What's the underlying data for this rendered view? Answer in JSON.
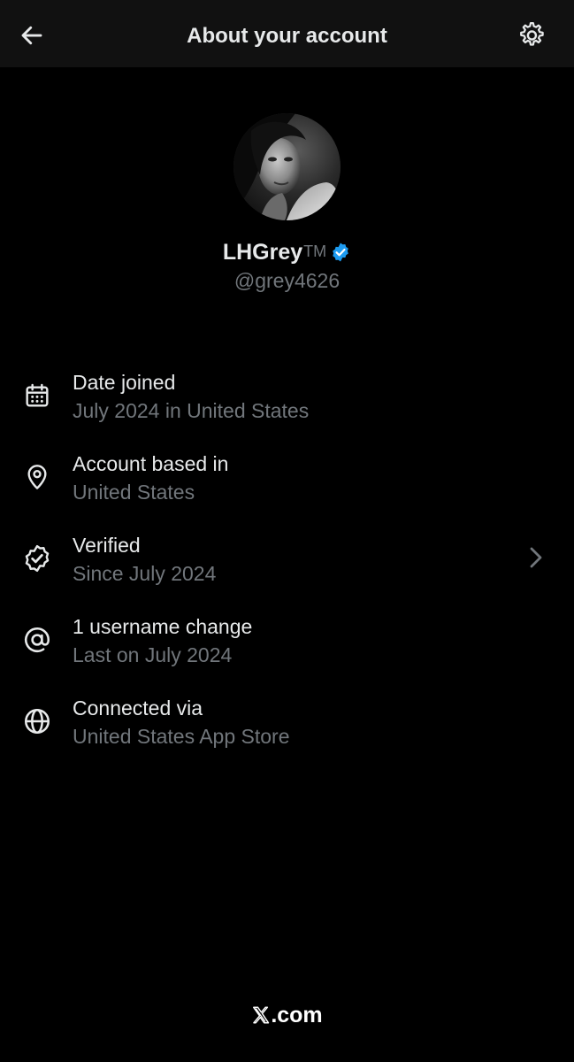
{
  "header": {
    "title": "About your account",
    "back_icon": "arrow-left-icon",
    "settings_icon": "gear-icon"
  },
  "profile": {
    "display_name": "LHGrey",
    "trademark": "TM",
    "handle": "@grey4626",
    "verified_badge_color": "#1d9bf0"
  },
  "details": [
    {
      "icon": "calendar-icon",
      "title": "Date joined",
      "value": "July 2024 in United States"
    },
    {
      "icon": "location-pin-icon",
      "title": "Account based in",
      "value": "United States"
    },
    {
      "icon": "verified-badge-icon",
      "title": "Verified",
      "value": "Since July 2024"
    },
    {
      "icon": "at-sign-icon",
      "title": "1 username change",
      "value": "Last on July 2024"
    },
    {
      "icon": "globe-icon",
      "title": "Connected via",
      "value": "United States App Store"
    }
  ],
  "footer": {
    "brand_suffix": ".com"
  },
  "colors": {
    "background": "#000000",
    "header_background": "#111111",
    "primary_text": "#e7e9ea",
    "secondary_text": "#71767b",
    "accent": "#1d9bf0"
  }
}
